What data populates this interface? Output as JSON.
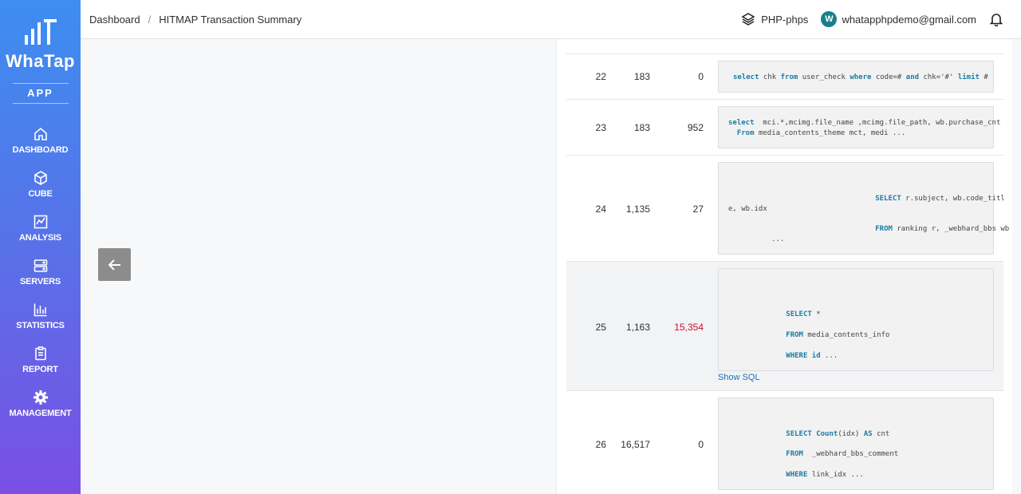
{
  "sidebar": {
    "brand": "WhaTap",
    "app_label": "APP",
    "items": [
      {
        "label": "DASHBOARD",
        "icon": "home-icon"
      },
      {
        "label": "CUBE",
        "icon": "cube-icon"
      },
      {
        "label": "ANALYSIS",
        "icon": "analysis-icon"
      },
      {
        "label": "SERVERS",
        "icon": "servers-icon"
      },
      {
        "label": "STATISTICS",
        "icon": "statistics-icon"
      },
      {
        "label": "REPORT",
        "icon": "report-icon"
      },
      {
        "label": "MANAGEMENT",
        "icon": "gear-icon"
      }
    ]
  },
  "header": {
    "breadcrumb": [
      "Dashboard",
      "HITMAP Transaction Summary"
    ],
    "breadcrumb_sep": "/",
    "project": "PHP-phps",
    "user_initial": "W",
    "user_email": "whatapphpdemo@gmail.com"
  },
  "table": {
    "rows": [
      {
        "no": "22",
        "count": "183",
        "value": "0",
        "sql": [
          [
            [
              "kw",
              "select"
            ],
            [
              "t",
              " chk "
            ],
            [
              "kw",
              "from"
            ],
            [
              "t",
              " user_check "
            ],
            [
              "kw",
              "where"
            ],
            [
              "t",
              " code=# "
            ],
            [
              "kw",
              "and"
            ],
            [
              "t",
              " chk='#' "
            ],
            [
              "kw",
              "limit"
            ],
            [
              "t",
              " #"
            ]
          ]
        ]
      },
      {
        "no": "23",
        "count": "183",
        "value": "952",
        "sql": [
          [
            [
              "kw",
              "select"
            ],
            [
              "t",
              "  mci.*,mcimg.file_name ,mcimg.file_path, wb.purchase_cnt"
            ]
          ],
          [
            [
              "t",
              "  "
            ],
            [
              "kw",
              "From"
            ],
            [
              "t",
              " media_contents_theme mct, medi ..."
            ]
          ]
        ]
      },
      {
        "no": "24",
        "count": "1,135",
        "value": "27",
        "sql": [
          [
            [
              "t",
              "                                  "
            ],
            [
              "kw",
              "SELECT"
            ],
            [
              "t",
              " r.subject, wb.code_titl"
            ]
          ],
          [
            [
              "t",
              "e, wb.idx"
            ]
          ],
          [
            [
              "t",
              "                                  "
            ],
            [
              "kw",
              "FROM"
            ],
            [
              "t",
              " ranking r, _webhard_bbs wb"
            ]
          ],
          [
            [
              "t",
              "          ..."
            ]
          ]
        ]
      },
      {
        "no": "25",
        "count": "1,163",
        "value": "15,354",
        "highlight": true,
        "sql": [
          [
            [
              "t",
              "               "
            ],
            [
              "kw",
              "SELECT"
            ],
            [
              "t",
              " *"
            ]
          ],
          [
            [
              "t",
              "               "
            ],
            [
              "kw",
              "FROM"
            ],
            [
              "t",
              " media_contents_info"
            ]
          ],
          [
            [
              "t",
              "               "
            ],
            [
              "kw",
              "WHERE"
            ],
            [
              "t",
              " "
            ],
            [
              "kw",
              "id"
            ],
            [
              "t",
              " ..."
            ]
          ]
        ],
        "show_sql": "Show SQL"
      },
      {
        "no": "26",
        "count": "16,517",
        "value": "0",
        "sql": [
          [
            [
              "t",
              "               "
            ],
            [
              "kw",
              "SELECT"
            ],
            [
              "t",
              " "
            ],
            [
              "kw",
              "Count"
            ],
            [
              "t",
              "(idx) "
            ],
            [
              "kw",
              "AS"
            ],
            [
              "t",
              " cnt"
            ]
          ],
          [
            [
              "t",
              "               "
            ],
            [
              "kw",
              "FROM"
            ],
            [
              "t",
              "  _webhard_bbs_comment"
            ]
          ],
          [
            [
              "t",
              "               "
            ],
            [
              "kw",
              "WHERE"
            ],
            [
              "t",
              " link_idx ..."
            ]
          ]
        ]
      }
    ]
  },
  "colors": {
    "accent": "#3d8ef0",
    "keyword": "#1a7ca3",
    "highlight_value": "#c8102e",
    "link": "#1d6fc2"
  }
}
